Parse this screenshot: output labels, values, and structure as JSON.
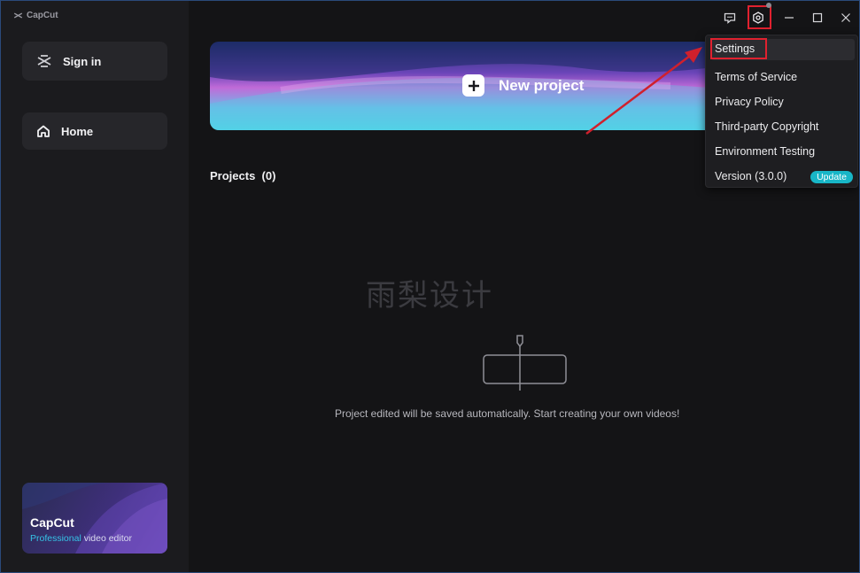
{
  "app": {
    "title": "CapCut"
  },
  "sidebar": {
    "sign_in": "Sign in",
    "home": "Home",
    "promo": {
      "title": "CapCut",
      "subtitle_accent": "Professional",
      "subtitle_rest": " video editor"
    }
  },
  "main": {
    "new_project": "New project",
    "projects_label": "Projects",
    "projects_count": "(0)",
    "watermark": "雨梨设计",
    "empty_message": "Project edited will be saved automatically. Start creating your own videos!"
  },
  "settings_menu": {
    "items": [
      "Settings",
      "Terms of Service",
      "Privacy Policy",
      "Third-party Copyright",
      "Environment Testing",
      "Version (3.0.0)"
    ],
    "update_badge": "Update"
  },
  "colors": {
    "highlight": "#e0212f",
    "accent_teal": "#18b6c7",
    "background": "#151517"
  },
  "icons": [
    "capcut-logo-icon",
    "feedback-icon",
    "settings-gear-icon",
    "minimize-icon",
    "maximize-icon",
    "close-icon",
    "home-icon",
    "plus-icon"
  ]
}
